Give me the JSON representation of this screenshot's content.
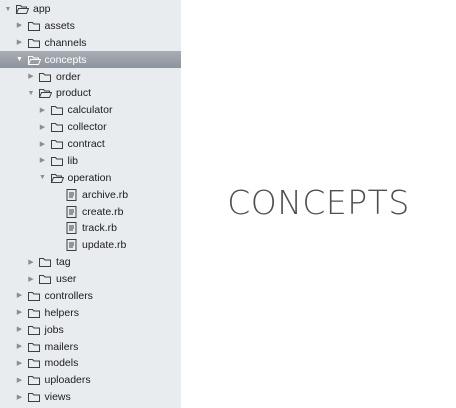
{
  "sidebar": {
    "items": [
      {
        "label": "app",
        "type": "folder",
        "expanded": true,
        "depth": 0
      },
      {
        "label": "assets",
        "type": "folder",
        "expanded": false,
        "depth": 1
      },
      {
        "label": "channels",
        "type": "folder",
        "expanded": false,
        "depth": 1
      },
      {
        "label": "concepts",
        "type": "folder",
        "expanded": true,
        "depth": 1,
        "selected": true
      },
      {
        "label": "order",
        "type": "folder",
        "expanded": false,
        "depth": 2
      },
      {
        "label": "product",
        "type": "folder",
        "expanded": true,
        "depth": 2
      },
      {
        "label": "calculator",
        "type": "folder",
        "expanded": false,
        "depth": 3
      },
      {
        "label": "collector",
        "type": "folder",
        "expanded": false,
        "depth": 3
      },
      {
        "label": "contract",
        "type": "folder",
        "expanded": false,
        "depth": 3
      },
      {
        "label": "lib",
        "type": "folder",
        "expanded": false,
        "depth": 3
      },
      {
        "label": "operation",
        "type": "folder",
        "expanded": true,
        "depth": 3
      },
      {
        "label": "archive.rb",
        "type": "file",
        "depth": 4
      },
      {
        "label": "create.rb",
        "type": "file",
        "depth": 4
      },
      {
        "label": "track.rb",
        "type": "file",
        "depth": 4
      },
      {
        "label": "update.rb",
        "type": "file",
        "depth": 4
      },
      {
        "label": "tag",
        "type": "folder",
        "expanded": false,
        "depth": 2
      },
      {
        "label": "user",
        "type": "folder",
        "expanded": false,
        "depth": 2
      },
      {
        "label": "controllers",
        "type": "folder",
        "expanded": false,
        "depth": 1
      },
      {
        "label": "helpers",
        "type": "folder",
        "expanded": false,
        "depth": 1
      },
      {
        "label": "jobs",
        "type": "folder",
        "expanded": false,
        "depth": 1
      },
      {
        "label": "mailers",
        "type": "folder",
        "expanded": false,
        "depth": 1
      },
      {
        "label": "models",
        "type": "folder",
        "expanded": false,
        "depth": 1
      },
      {
        "label": "uploaders",
        "type": "folder",
        "expanded": false,
        "depth": 1
      },
      {
        "label": "views",
        "type": "folder",
        "expanded": false,
        "depth": 1
      }
    ]
  },
  "main": {
    "title": "CONCEPTS"
  }
}
